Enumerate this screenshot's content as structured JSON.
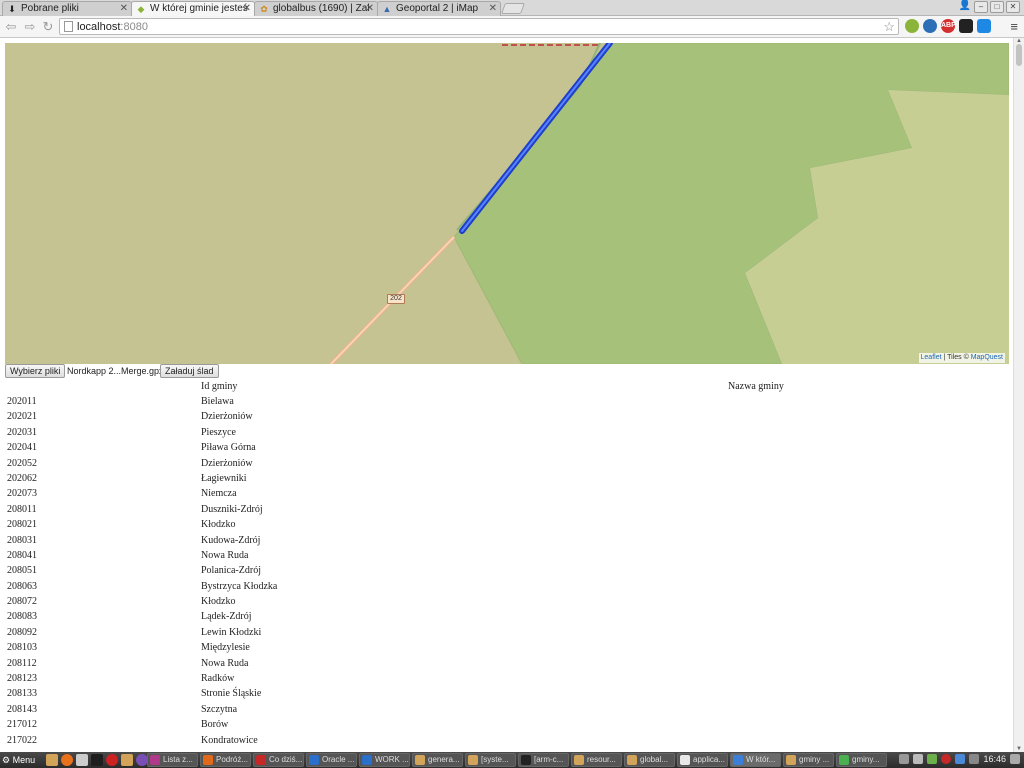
{
  "browser": {
    "tabs": [
      {
        "title": "Pobrane pliki",
        "icon": "download-icon"
      },
      {
        "title": "W której gminie jesteś",
        "icon": "leaf-icon"
      },
      {
        "title": "globalbus (1690) | Zal",
        "icon": "puzzle-icon"
      },
      {
        "title": "Geoportal 2 | iMap",
        "icon": "map-icon"
      }
    ],
    "active_tab": 1,
    "url_host": "localhost",
    "url_port": ":8080"
  },
  "map": {
    "road_label": "202",
    "attribution": {
      "leaflet": "Leaflet",
      "sep": " | Tiles © ",
      "provider": "MapQuest"
    }
  },
  "upload": {
    "choose_label": "Wybierz pliki",
    "chosen_file": "Nordkapp 2...Merge.gpx",
    "load_label": "Załaduj ślad"
  },
  "table": {
    "headers": {
      "id": "Id gminy",
      "name": "Nazwa gminy"
    },
    "rows": [
      {
        "id": "202011",
        "name": "Bielawa"
      },
      {
        "id": "202021",
        "name": "Dzierżoniów"
      },
      {
        "id": "202031",
        "name": "Pieszyce"
      },
      {
        "id": "202041",
        "name": "Piława Górna"
      },
      {
        "id": "202052",
        "name": "Dzierżoniów"
      },
      {
        "id": "202062",
        "name": "Łagiewniki"
      },
      {
        "id": "202073",
        "name": "Niemcza"
      },
      {
        "id": "208011",
        "name": "Duszniki-Zdrój"
      },
      {
        "id": "208021",
        "name": "Kłodzko"
      },
      {
        "id": "208031",
        "name": "Kudowa-Zdrój"
      },
      {
        "id": "208041",
        "name": "Nowa Ruda"
      },
      {
        "id": "208051",
        "name": "Polanica-Zdrój"
      },
      {
        "id": "208063",
        "name": "Bystrzyca Kłodzka"
      },
      {
        "id": "208072",
        "name": "Kłodzko"
      },
      {
        "id": "208083",
        "name": "Lądek-Zdrój"
      },
      {
        "id": "208092",
        "name": "Lewin Kłodzki"
      },
      {
        "id": "208103",
        "name": "Międzylesie"
      },
      {
        "id": "208112",
        "name": "Nowa Ruda"
      },
      {
        "id": "208123",
        "name": "Radków"
      },
      {
        "id": "208133",
        "name": "Stronie Śląskie"
      },
      {
        "id": "208143",
        "name": "Szczytna"
      },
      {
        "id": "217012",
        "name": "Borów"
      },
      {
        "id": "217022",
        "name": "Kondratowice"
      }
    ]
  },
  "taskbar": {
    "menu_label": "Menu",
    "tasks": [
      {
        "label": "Lista z...",
        "color": "#b03a8a"
      },
      {
        "label": "Podróż...",
        "color": "#e06a1a"
      },
      {
        "label": "Co dziś...",
        "color": "#c62828"
      },
      {
        "label": "Oracle ...",
        "color": "#2a6fc9"
      },
      {
        "label": "WORK ...",
        "color": "#2a6fc9"
      },
      {
        "label": "genera...",
        "color": "#d2a45a"
      },
      {
        "label": "[syste...",
        "color": "#d2a45a"
      },
      {
        "label": "[arm-c...",
        "color": "#222222"
      },
      {
        "label": "resour...",
        "color": "#d2a45a"
      },
      {
        "label": "global...",
        "color": "#d2a45a"
      },
      {
        "label": "applica...",
        "color": "#e8e8e8"
      },
      {
        "label": "W któr...",
        "color": "#3b7fd8"
      },
      {
        "label": "gminy ...",
        "color": "#d2a45a"
      },
      {
        "label": "gminy...",
        "color": "#4caf50"
      }
    ],
    "active_task": 11,
    "clock": "16:46"
  },
  "colors": {
    "map_tan": "#c6c392",
    "map_green": "#a5c17a",
    "map_light": "#c6ce94",
    "track_blue": "#2a56d8",
    "road": "#f2c9a8"
  }
}
